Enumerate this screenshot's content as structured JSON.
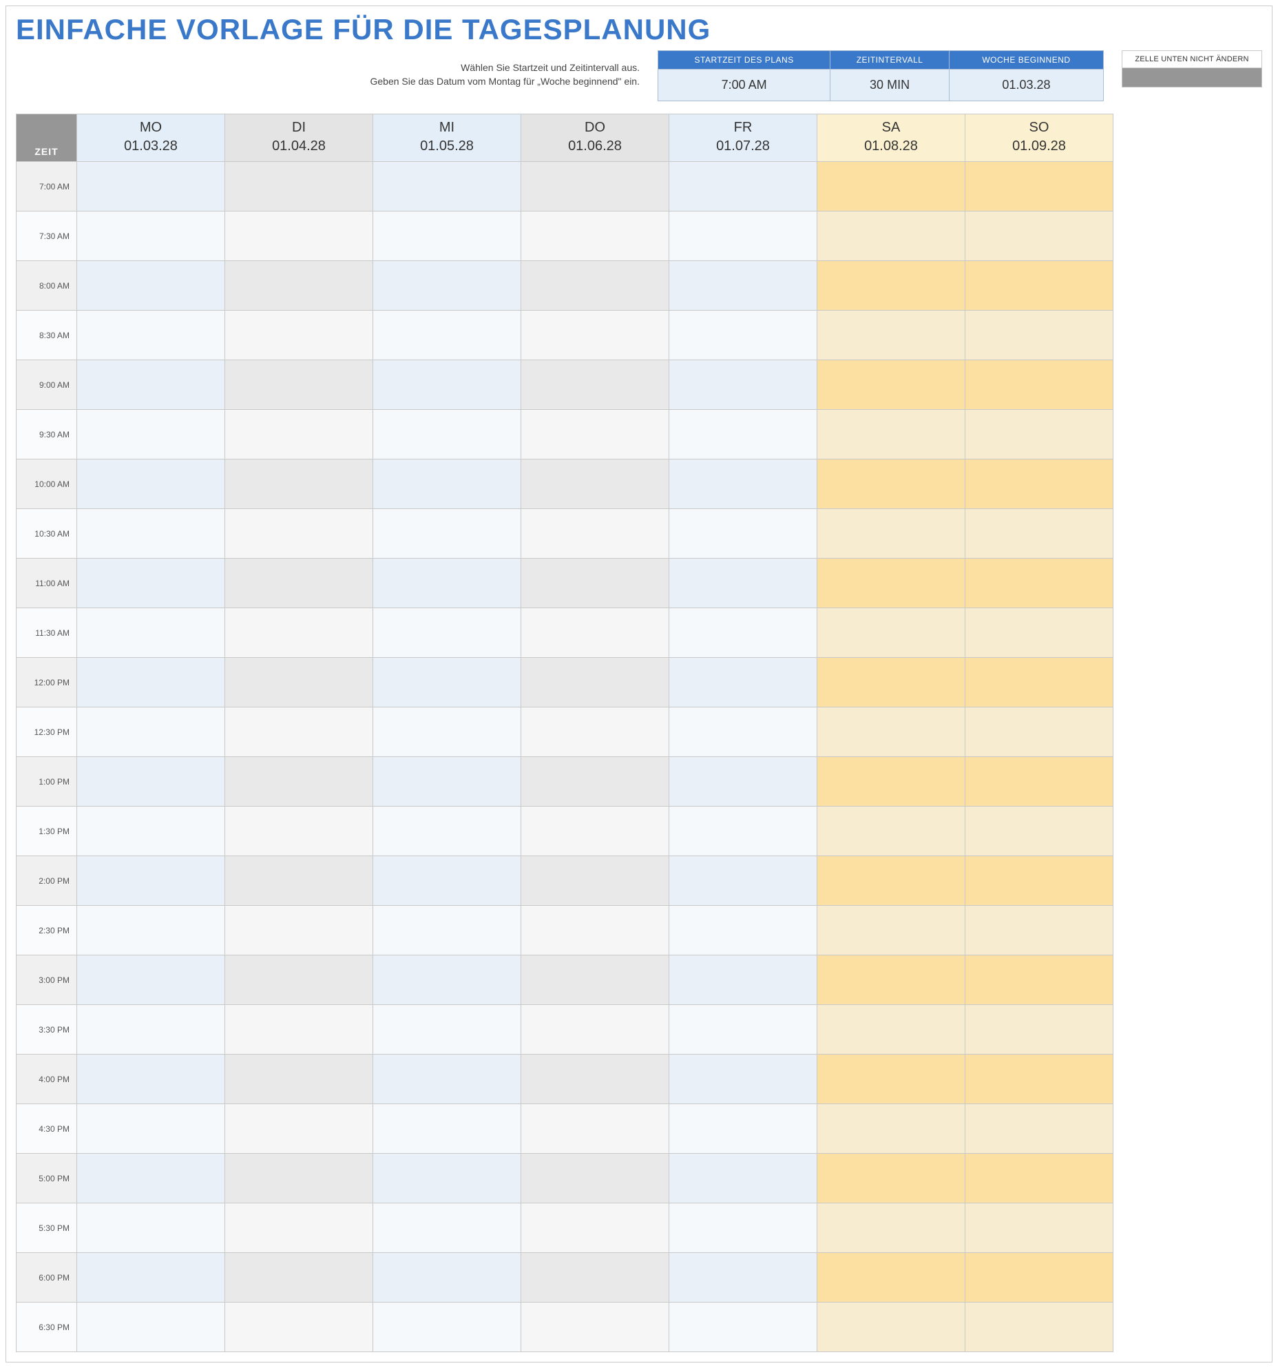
{
  "title": "EINFACHE VORLAGE FÜR DIE TAGESPLANUNG",
  "instructions": {
    "line1": "Wählen Sie Startzeit und Zeitintervall aus.",
    "line2": "Geben Sie das Datum vom Montag für „Woche beginnend\" ein."
  },
  "params": {
    "headers": {
      "start": "STARTZEIT DES PLANS",
      "interval": "ZEITINTERVALL",
      "week": "WOCHE BEGINNEND"
    },
    "values": {
      "start": "7:00 AM",
      "interval": "30 MIN",
      "week": "01.03.28"
    }
  },
  "side_note": {
    "header": "ZELLE UNTEN NICHT ÄNDERN"
  },
  "zeit_label": "ZEIT",
  "days": [
    {
      "name": "MO",
      "date": "01.03.28",
      "type": "blue"
    },
    {
      "name": "DI",
      "date": "01.04.28",
      "type": "grey"
    },
    {
      "name": "MI",
      "date": "01.05.28",
      "type": "blue"
    },
    {
      "name": "DO",
      "date": "01.06.28",
      "type": "grey"
    },
    {
      "name": "FR",
      "date": "01.07.28",
      "type": "blue"
    },
    {
      "name": "SA",
      "date": "01.08.28",
      "type": "cream"
    },
    {
      "name": "SO",
      "date": "01.09.28",
      "type": "cream"
    }
  ],
  "times": [
    "7:00 AM",
    "7:30 AM",
    "8:00 AM",
    "8:30 AM",
    "9:00 AM",
    "9:30 AM",
    "10:00 AM",
    "10:30 AM",
    "11:00 AM",
    "11:30 AM",
    "12:00 PM",
    "12:30 PM",
    "1:00 PM",
    "1:30 PM",
    "2:00 PM",
    "2:30 PM",
    "3:00 PM",
    "3:30 PM",
    "4:00 PM",
    "4:30 PM",
    "5:00 PM",
    "5:30 PM",
    "6:00 PM",
    "6:30 PM"
  ]
}
